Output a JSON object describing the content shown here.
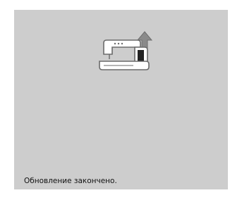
{
  "screen": {
    "status_message": "Обновление закончено.",
    "icon": "sewing-machine-update-icon",
    "colors": {
      "background": "#cdcdcd",
      "machine_body": "#ffffff",
      "machine_outline": "#6b6b6b",
      "arrow": "#8a8a8a",
      "panel_dark": "#222222"
    }
  }
}
